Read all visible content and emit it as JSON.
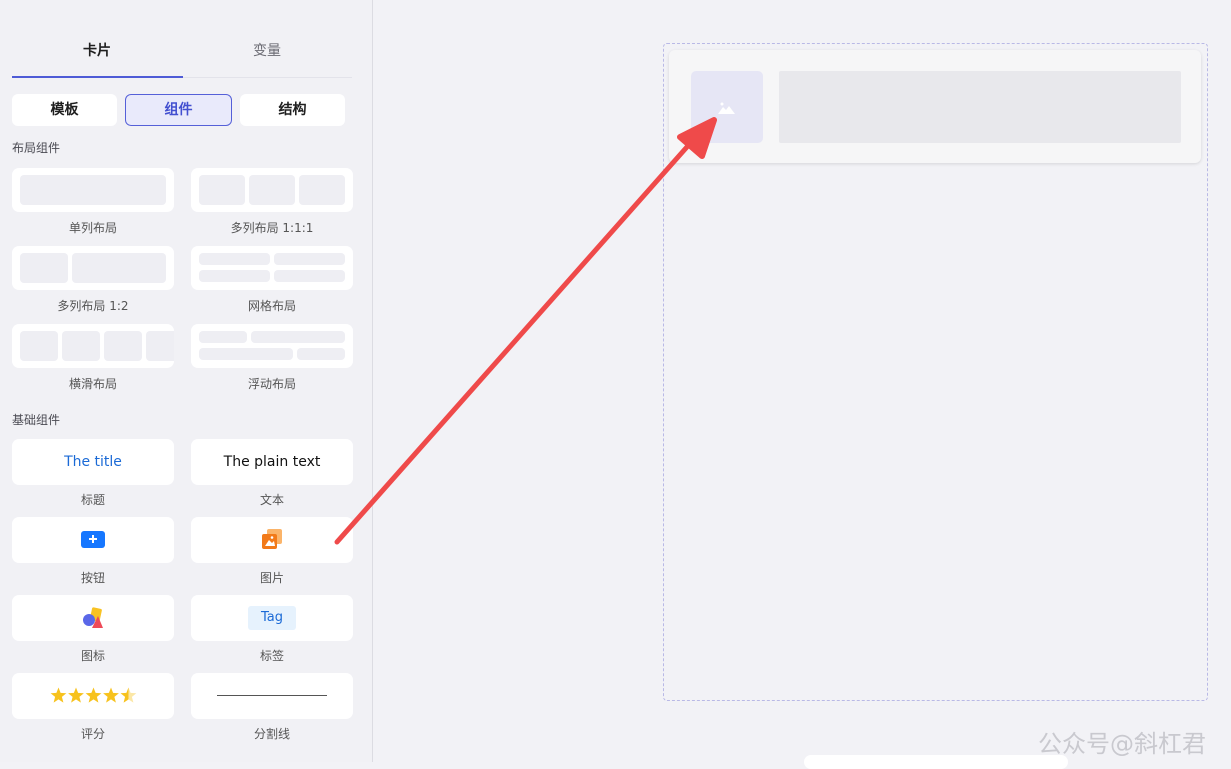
{
  "tabs": {
    "card": "卡片",
    "variable": "变量"
  },
  "segments": {
    "template": "模板",
    "component": "组件",
    "structure": "结构"
  },
  "layout_section": {
    "title": "布局组件",
    "items": [
      "单列布局",
      "多列布局 1:1:1",
      "多列布局 1:2",
      "网格布局",
      "横滑布局",
      "浮动布局"
    ]
  },
  "basic_section": {
    "title": "基础组件",
    "items": [
      "标题",
      "文本",
      "按钮",
      "图片",
      "图标",
      "标签",
      "评分",
      "分割线"
    ]
  },
  "previews": {
    "title_text": "The title",
    "plain_text": "The plain text",
    "tag_text": "Tag"
  },
  "colors": {
    "accent": "#4e5bd6",
    "arrow": "#ef4a4a",
    "star": "#f7c21d",
    "title_blue": "#1b6ad6"
  },
  "watermark": "公众号@斜杠君"
}
